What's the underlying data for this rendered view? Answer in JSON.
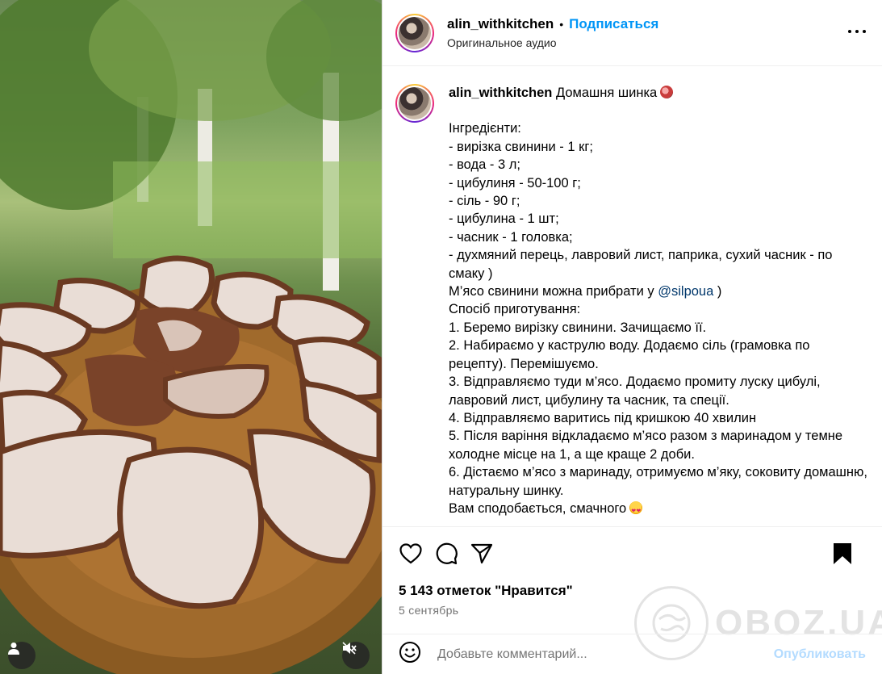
{
  "post": {
    "username": "alin_withkitchen",
    "follow_label": "Подписаться",
    "separator": "•",
    "audio": "Оригинальное аудио",
    "more_icon": "more-horizontal-icon"
  },
  "caption": {
    "username": "alin_withkitchen",
    "title": "Домашня шинка",
    "title_emoji": "meat-emoji",
    "lines": [
      "Інгредієнти:",
      "- вирізка свинини - 1 кг;",
      "- вода - 3 л;",
      "- цибулиня - 50-100 г;",
      "- сіль - 90 г;",
      "- цибулина - 1 шт;",
      "- часник - 1 головка;",
      "- духмяний перець, лавровий лист, паприка, сухий часник - по смаку )"
    ],
    "mention_prefix": "М’ясо свинини можна прибрати у ",
    "mention": "@silpoua",
    "mention_suffix": " )",
    "method_lines": [
      "Спосіб приготування:",
      "1. Беремо вирізку свинини. Зачищаємо її.",
      "2. Набираємо у каструлю воду. Додаємо сіль (грамовка по рецепту). Перемішуємо.",
      "3. Відправляємо туди м’ясо. Додаємо промиту луску цибулі, лавровий лист, цибулину та часник, та спеції.",
      "4. Відправляємо варитись під кришкою 40 хвилин",
      "5. Після варіння відкладаємо м’ясо разом з маринадом у темне холодне місце на 1, а ще краще 2 доби.",
      "6. Дістаємо м’ясо з маринаду, отримуємо м’яку, соковиту домашню, натуральну шинку."
    ],
    "closing": "Вам сподобається, смачного",
    "closing_emoji": "heart-eyes-emoji"
  },
  "actions": {
    "like_icon": "heart-icon",
    "comment_icon": "comment-icon",
    "share_icon": "share-icon",
    "save_icon": "bookmark-icon"
  },
  "likes_text": "5 143 отметок \"Нравится\"",
  "date_text": "5 сентябрь",
  "comment": {
    "placeholder": "Добавьте комментарий...",
    "publish_label": "Опубликовать",
    "emoji_icon": "smiley-icon"
  },
  "watermark": "OBOZ.UA",
  "media": {
    "user_icon": "user-tag-icon",
    "mute_icon": "speaker-muted-icon"
  },
  "colors": {
    "accent": "#0095f6",
    "mention": "#00376b",
    "publish_disabled": "#b3dbff",
    "secondary_text": "#737373"
  }
}
